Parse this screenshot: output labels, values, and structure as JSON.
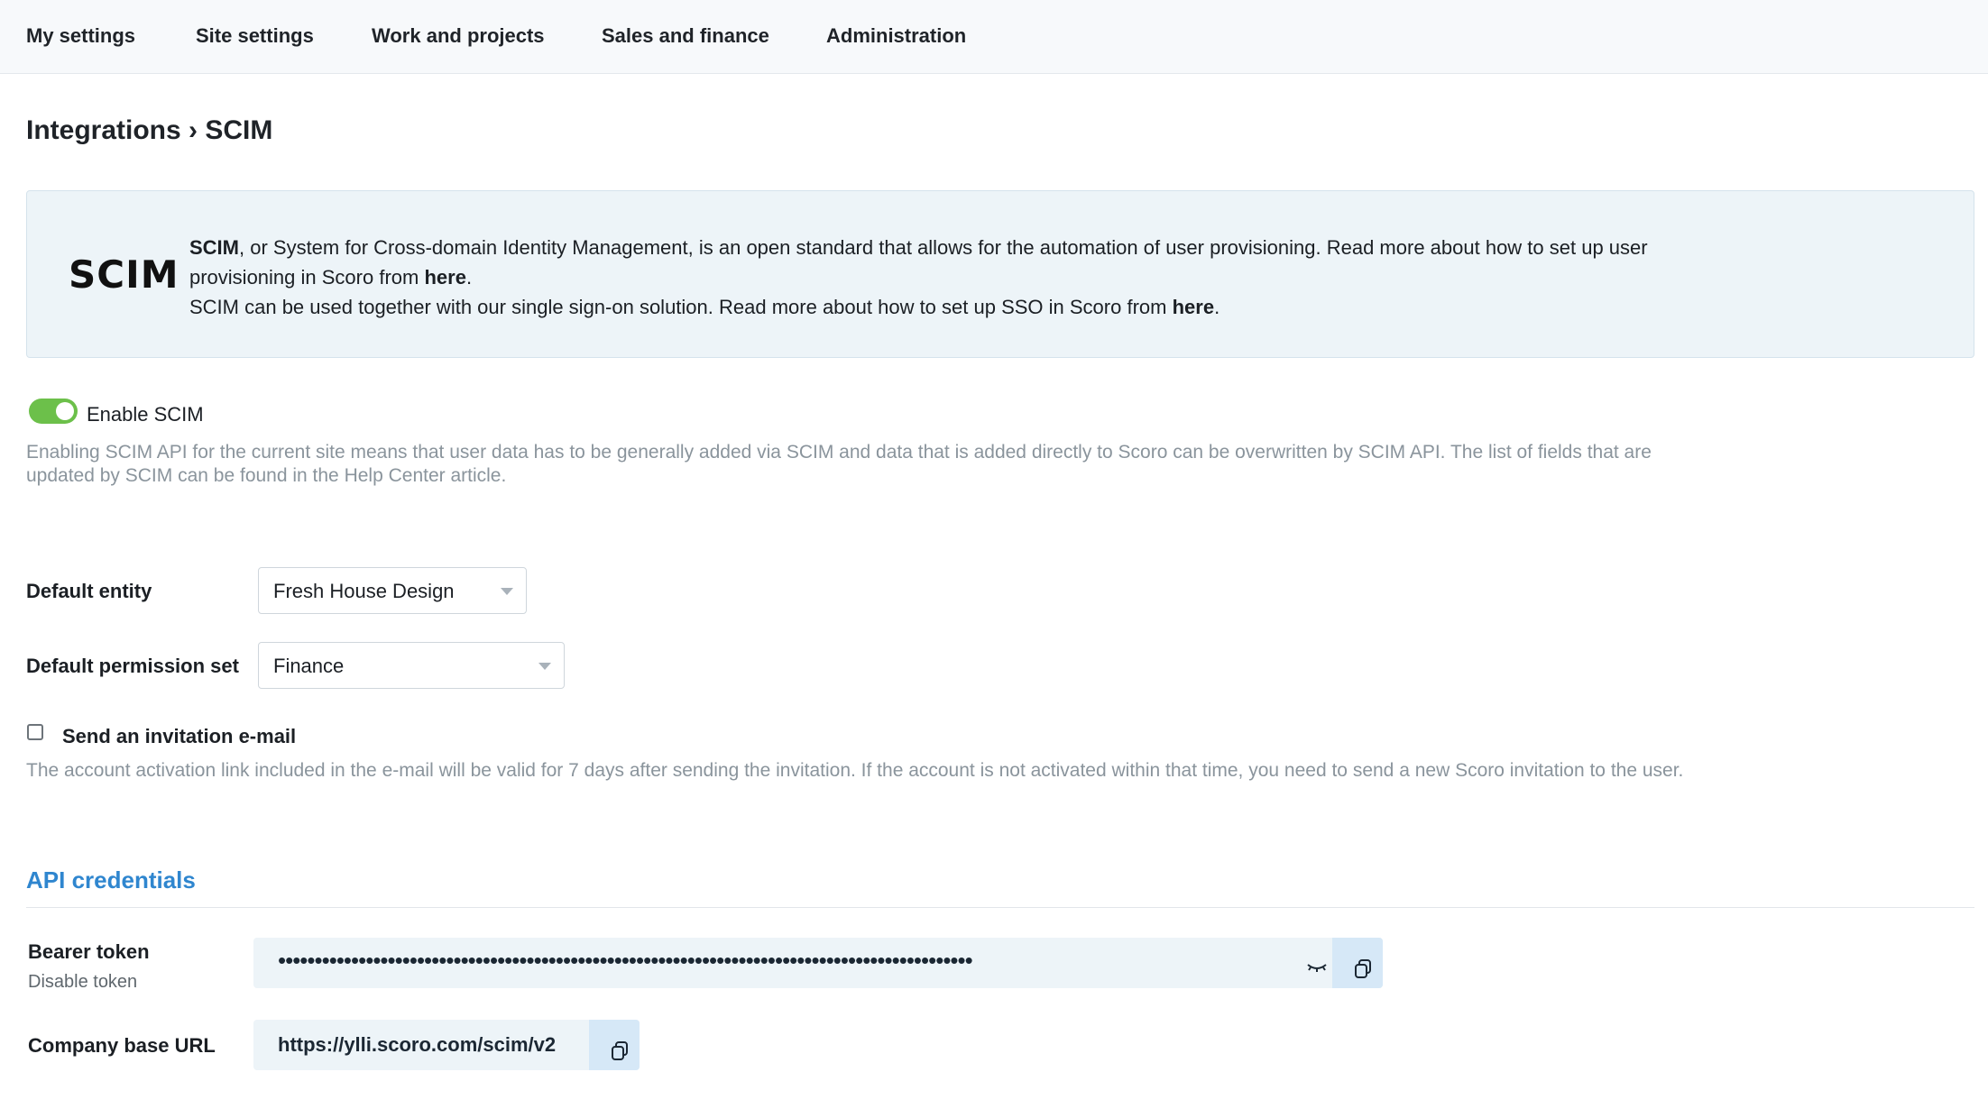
{
  "nav": {
    "items": [
      "My settings",
      "Site settings",
      "Work and projects",
      "Sales and finance",
      "Administration"
    ]
  },
  "page": {
    "title": "Integrations › SCIM"
  },
  "info": {
    "logo": "SCIM",
    "p1_bold": "SCIM",
    "p1_text": ", or System for Cross-domain Identity Management, is an open standard that allows for the automation of user provisioning. Read more about how to set up user provisioning in Scoro from ",
    "p1_link": "here",
    "p1_end": ".",
    "p2_text": "SCIM can be used together with our single sign-on solution. Read more about how to set up SSO in Scoro from ",
    "p2_link": "here",
    "p2_end": "."
  },
  "enable_scim": {
    "label": "Enable SCIM",
    "on": true,
    "help": "Enabling SCIM API for the current site means that user data has to be generally added via SCIM and data that is added directly to Scoro can be overwritten by SCIM API. The list of fields that are updated by SCIM can be found in the Help Center article."
  },
  "default_entity": {
    "label": "Default entity",
    "value": "Fresh House Design"
  },
  "default_permission_set": {
    "label": "Default permission set",
    "value": "Finance"
  },
  "invitation": {
    "label": "Send an invitation e-mail",
    "checked": false,
    "help": "The account activation link included in the e-mail will be valid for 7 days after sending the invitation. If the account is not activated within that time, you need to send a new Scoro invitation to the user."
  },
  "api": {
    "title": "API credentials",
    "bearer_label": "Bearer token",
    "bearer_action": "Disable token",
    "bearer_masked": "•••••••••••••••••••••••••••••••••••••••••••••••••••••••••••••••••••••••••••••••••••••••••••••••",
    "url_label": "Company base URL",
    "url_value": "https://ylli.scoro.com/scim/v2"
  },
  "colors": {
    "accent": "#2f86cf",
    "toggle_on": "#6cc04a",
    "info_bg": "#edf4f8"
  },
  "icons": {
    "copy": "copy-icon",
    "reveal": "eye-closed-icon",
    "dropdown": "caret-down-icon"
  }
}
